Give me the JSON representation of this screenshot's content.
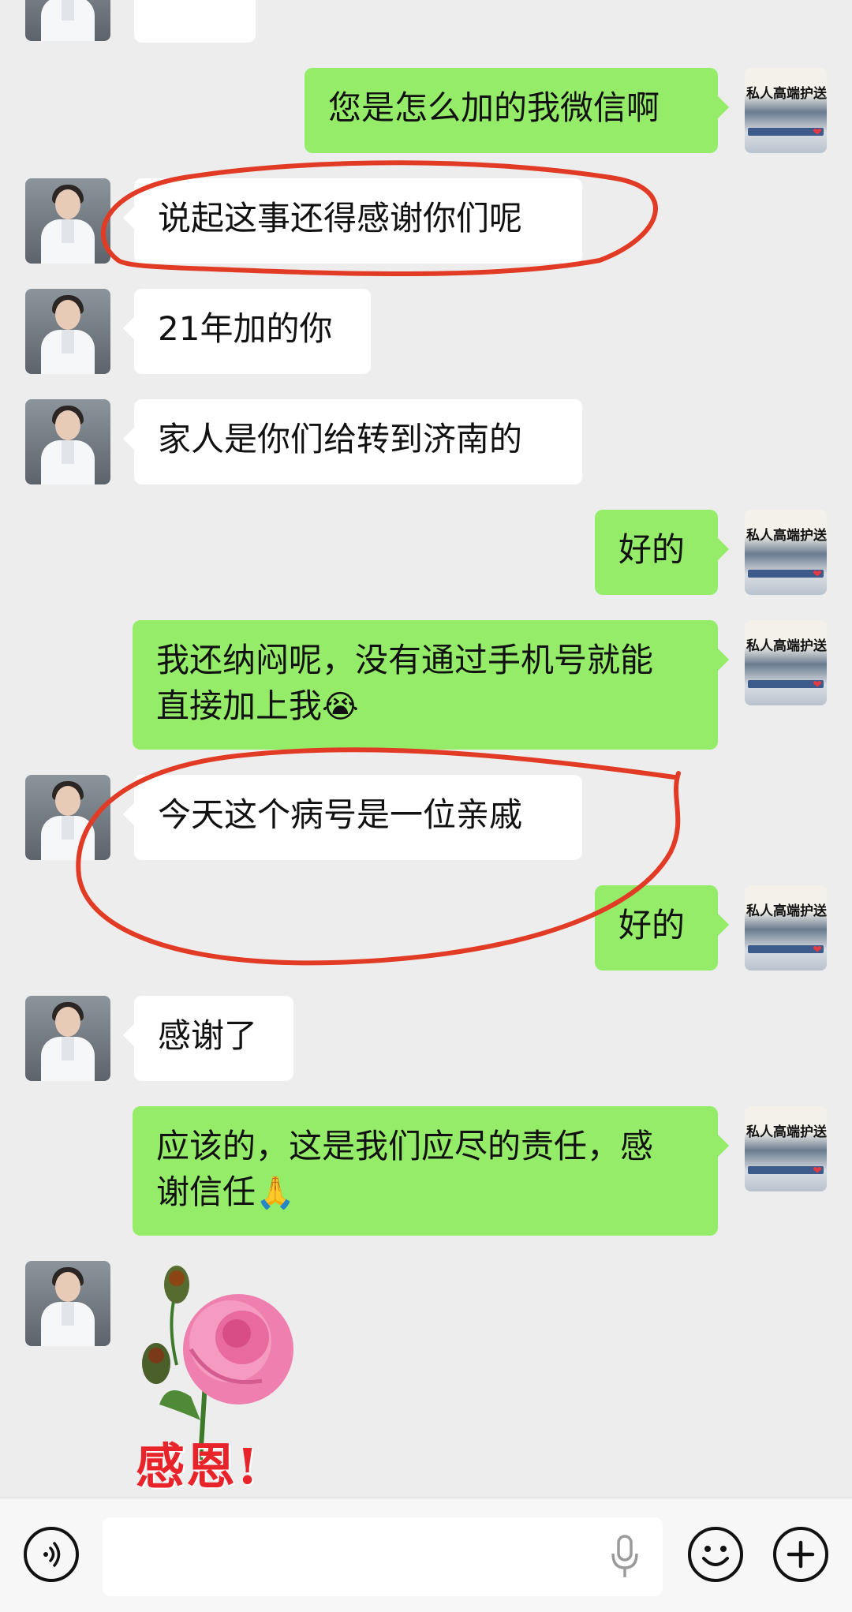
{
  "messages": [
    {
      "side": "right",
      "text": "您是怎么加的我微信啊"
    },
    {
      "side": "left",
      "text": "说起这事还得感谢你们呢"
    },
    {
      "side": "left",
      "text": "21年加的你"
    },
    {
      "side": "left",
      "text": "家人是你们给转到济南的"
    },
    {
      "side": "right",
      "text": "好的"
    },
    {
      "side": "right",
      "line1": "我还纳闷呢，没有通过手机号就能",
      "line2": "直接加上我",
      "emoji": "😭"
    },
    {
      "side": "left",
      "text": "今天这个病号是一位亲戚"
    },
    {
      "side": "right",
      "text": "好的"
    },
    {
      "side": "left",
      "text": "感谢了"
    },
    {
      "side": "right",
      "line1": "应该的，这是我们应尽的责任，感",
      "line2": "谢信任",
      "emoji": "🙏"
    },
    {
      "side": "left",
      "sticker": "rose-thanks-sticker",
      "sticker_text": "感恩!"
    }
  ],
  "avatars": {
    "self_badge_text": "私人高端护送"
  },
  "bottom_bar": {
    "input_value": "",
    "icons": [
      "voice-icon",
      "microphone-icon",
      "emoji-icon",
      "plus-icon"
    ]
  },
  "colors": {
    "background": "#ededed",
    "sent_bubble": "#95ec69",
    "received_bubble": "#ffffff",
    "annotation_ink": "#e23b25"
  }
}
